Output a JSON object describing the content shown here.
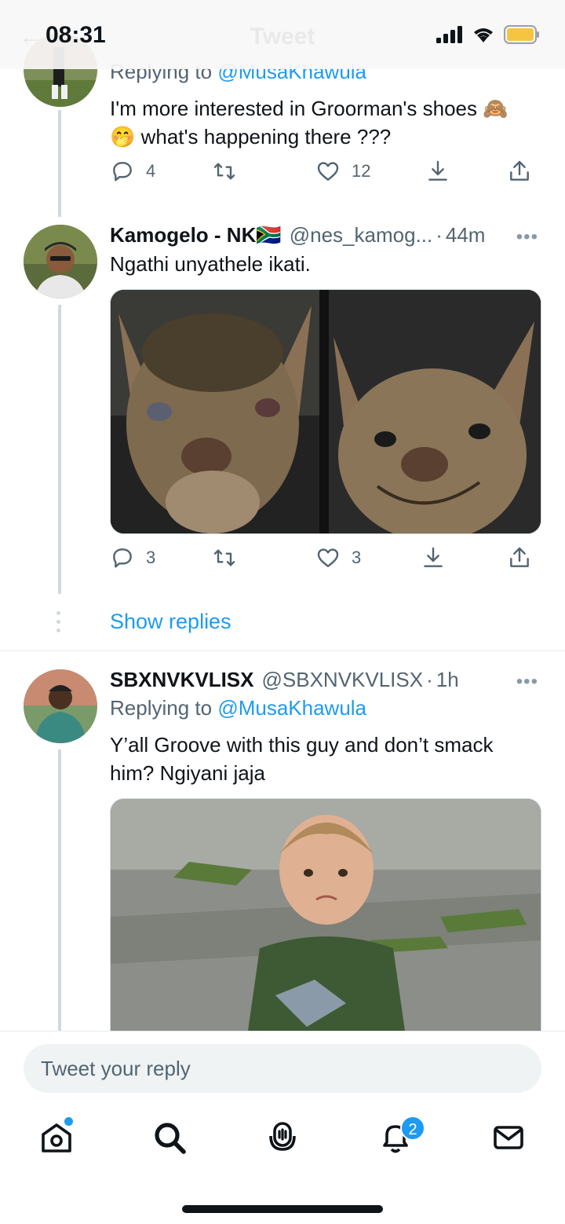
{
  "status_bar": {
    "time": "08:31"
  },
  "header": {
    "title": "Tweet"
  },
  "tweet1": {
    "reply_prefix": "Replying to",
    "reply_handle": "@MusaKhawula",
    "text_line1": "I'm more interested in Groorman's shoes 🙈",
    "text_line2": "🤭 what's happening there ???",
    "replies": "4",
    "likes": "12"
  },
  "tweet2": {
    "name": "Kamogelo - NK🇿🇦",
    "handle": "@nes_kamog...",
    "dot": "·",
    "time": "44m",
    "text": "Ngathi unyathele ikati.",
    "replies": "3",
    "likes": "3"
  },
  "show_replies": "Show replies",
  "tweet3": {
    "name": "SBXNVKVLISX",
    "handle": "@SBXNVKVLISX",
    "dot": "·",
    "time": "1h",
    "reply_prefix": "Replying to",
    "reply_handle": "@MusaKhawula",
    "text_line1": "Y’all Groove with this guy and don’t smack",
    "text_line2": "him? Ngiyani jaja"
  },
  "more_glyph": "•••",
  "reply_bar": {
    "placeholder": "Tweet your reply"
  },
  "tabbar": {
    "notifications_badge": "2"
  },
  "icons": [
    "back-arrow-icon",
    "signal-icon",
    "wifi-icon",
    "battery-icon",
    "reply-icon",
    "retweet-icon",
    "like-icon",
    "bookmark-icon",
    "share-icon",
    "more-icon",
    "home-icon",
    "search-icon",
    "spaces-icon",
    "notifications-icon",
    "messages-icon"
  ],
  "colors": {
    "accent": "#1d9bf0",
    "text": "#0f1419",
    "secondary": "#536471",
    "line": "#cfd9de"
  }
}
